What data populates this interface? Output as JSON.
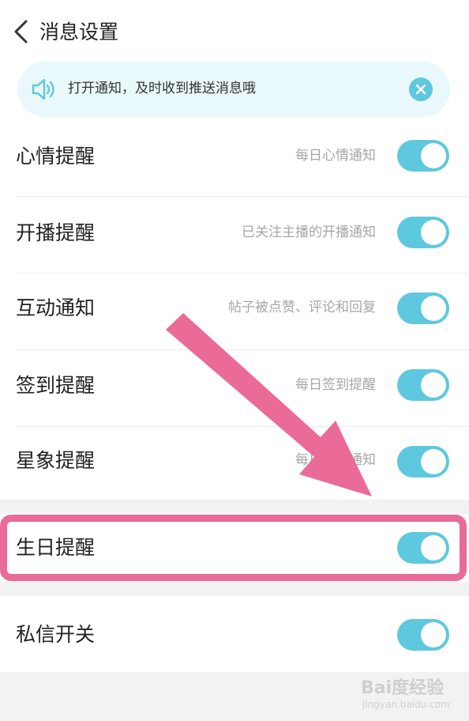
{
  "header": {
    "title": "消息设置",
    "back_icon": "chevron-left-icon"
  },
  "notice": {
    "text": "打开通知，及时收到推送消息哦",
    "icon": "speaker-icon",
    "close_icon": "close-icon",
    "background": "#e9f8fb"
  },
  "settings": {
    "items": [
      {
        "label": "心情提醒",
        "desc": "每日心情通知",
        "enabled": true
      },
      {
        "label": "开播提醒",
        "desc": "已关注主播的开播通知",
        "enabled": true
      },
      {
        "label": "互动通知",
        "desc": "帖子被点赞、评论和回复",
        "enabled": true
      },
      {
        "label": "签到提醒",
        "desc": "每日签到提醒",
        "enabled": true
      },
      {
        "label": "星象提醒",
        "desc": "每日星象通知",
        "enabled": true
      },
      {
        "label": "生日提醒",
        "desc": "",
        "enabled": true
      },
      {
        "label": "私信开关",
        "desc": "",
        "enabled": true
      }
    ]
  },
  "colors": {
    "toggle_on": "#5ec8de",
    "annotation": "#ea6b97",
    "page_background": "#f2f2f2"
  },
  "watermark": {
    "logo": "Bai度经验",
    "url": "jingyan.baidu.com"
  }
}
